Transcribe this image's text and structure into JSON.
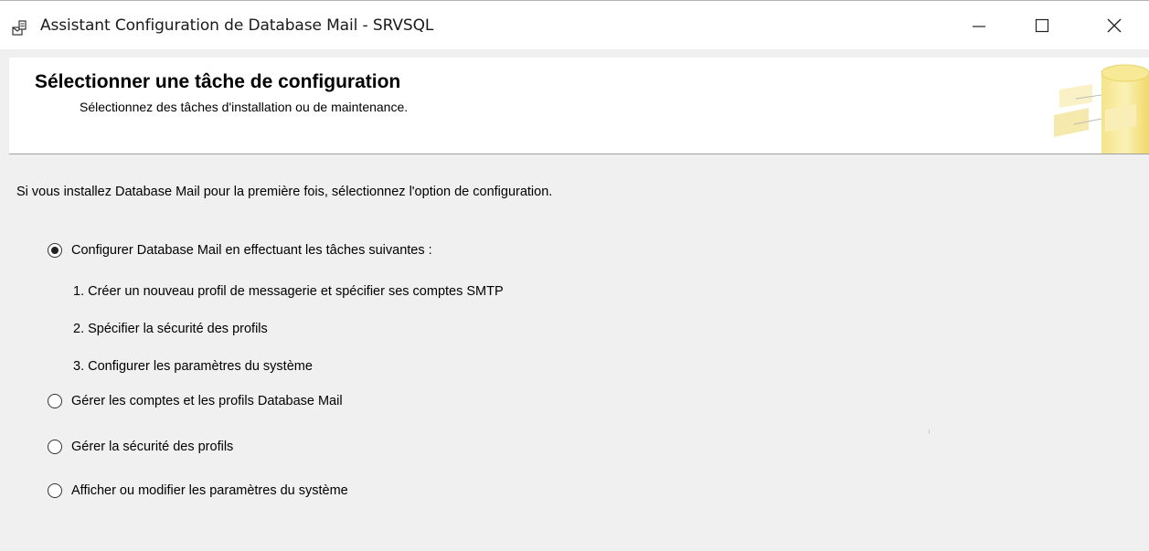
{
  "window": {
    "title": "Assistant Configuration de Database Mail - SRVSQL",
    "icons": {
      "app": "database-mail-wizard-icon",
      "minimize": "minimize-icon",
      "maximize": "maximize-icon",
      "close": "close-icon"
    }
  },
  "banner": {
    "title": "Sélectionner une tâche de configuration",
    "subtitle": "Sélectionnez des tâches d'installation ou de maintenance.",
    "art_icon": "database-wizard-banner-icon"
  },
  "main": {
    "intro": "Si vous installez Database Mail pour la première fois, sélectionnez l'option de configuration.",
    "options": [
      {
        "label": "Configurer Database Mail en effectuant les tâches suivantes :",
        "selected": true,
        "steps": [
          "1. Créer un nouveau profil de messagerie et spécifier ses comptes SMTP",
          "2. Spécifier la sécurité des profils",
          "3. Configurer les paramètres du système"
        ]
      },
      {
        "label": "Gérer les comptes et les profils Database Mail",
        "selected": false
      },
      {
        "label": "Gérer la sécurité des profils",
        "selected": false
      },
      {
        "label": "Afficher ou modifier les paramètres du système",
        "selected": false
      }
    ]
  },
  "colors": {
    "background": "#f0f0f0",
    "banner_bg": "#ffffff",
    "banner_art_yellow": "#f3e27a"
  }
}
